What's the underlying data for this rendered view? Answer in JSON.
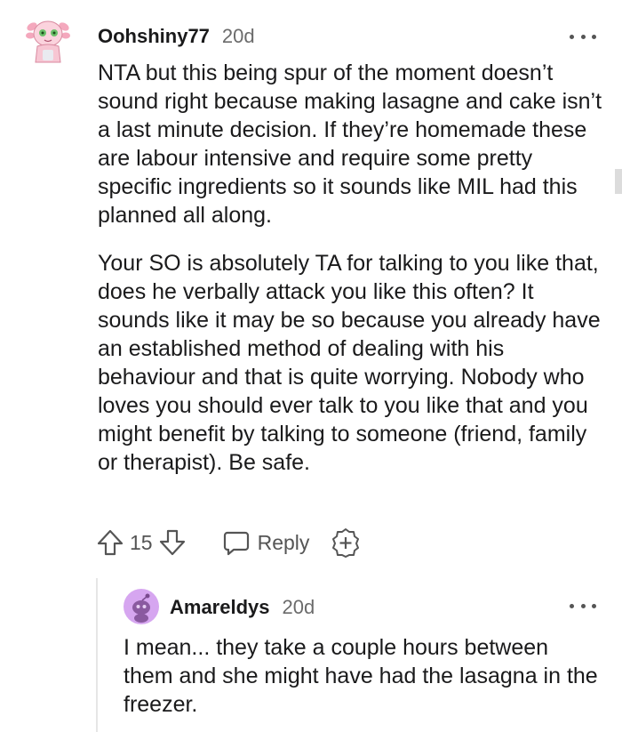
{
  "comment": {
    "username": "Oohshiny77",
    "age": "20d",
    "paragraphs": [
      "NTA but this being spur of the moment doesn’t sound right because making lasagne and cake isn’t a last minute decision. If they’re homemade these are labour intensive and require some pretty specific ingredients so it sounds like MIL had this planned all along.",
      "Your SO is absolutely TA for talking to you like that, does he verbally attack you like this often? It sounds like it may be so because you already have an established method of dealing with his behaviour and that is quite worrying. Nobody who loves you should ever talk to you like that and you might benefit by talking to someone (friend, family or therapist). Be safe."
    ],
    "score": "15",
    "reply_label": "Reply",
    "avatar_icon": "axolotl-avatar-icon",
    "accent_color": "#f6b7c7"
  },
  "reply": {
    "username": "Amareldys",
    "age": "20d",
    "text": "I mean... they take a couple hours between them and she might have had the lasagna in the freezer.",
    "avatar_icon": "snoo-avatar-icon",
    "accent_color": "#d6a6f0"
  },
  "icons": {
    "upvote": "upvote-arrow-icon",
    "downvote": "downvote-arrow-icon",
    "reply": "speech-bubble-icon",
    "award": "award-plus-icon",
    "more": "more-dots-icon"
  }
}
